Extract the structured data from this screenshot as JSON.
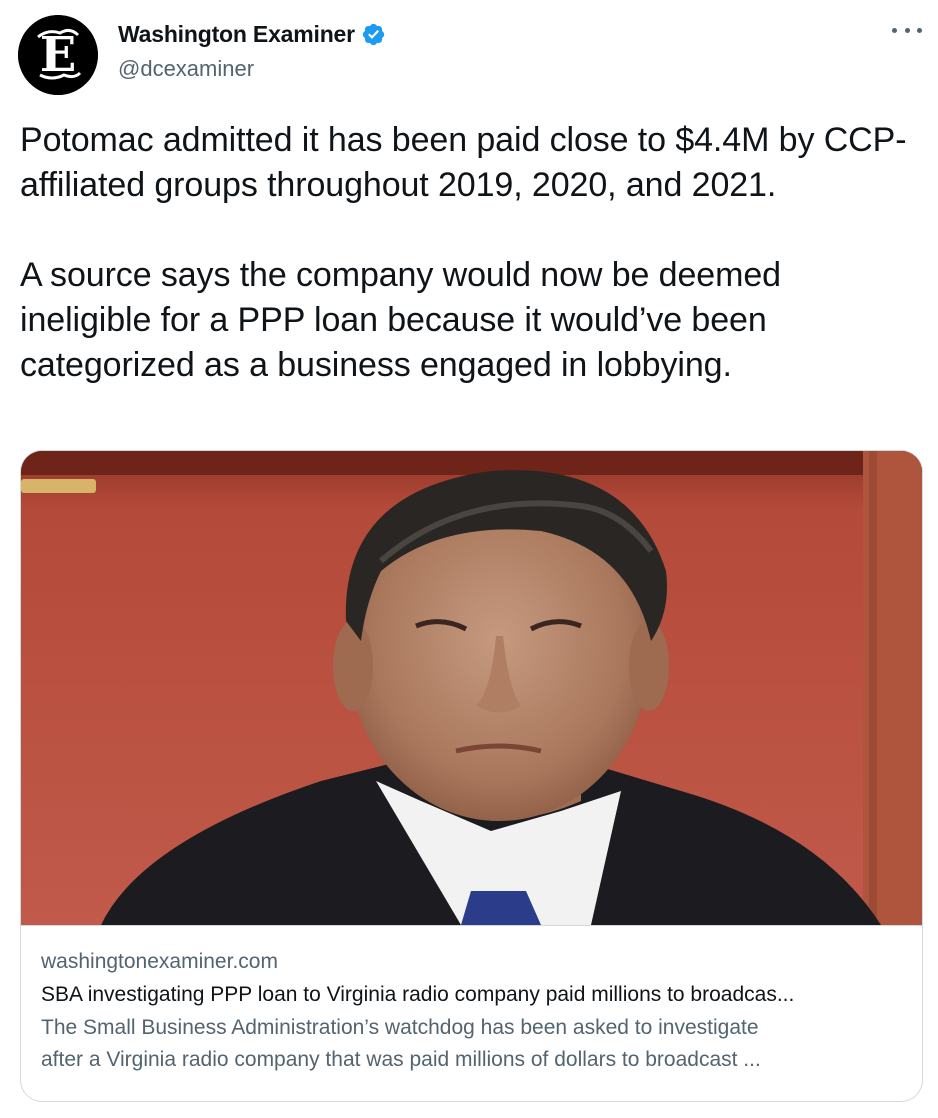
{
  "author": {
    "display_name": "Washington Examiner",
    "handle": "@dcexaminer",
    "verified": true,
    "avatar_glyph": "E"
  },
  "more_menu_icon": "more-horizontal-icon",
  "tweet": {
    "paragraphs": [
      "Potomac admitted it has been paid close to $4.4M by CCP-affiliated groups throughout 2019, 2020, and 2021.",
      "A source says the company would now be deemed ineligible for a PPP loan because it would’ve been categorized as a business engaged in lobbying."
    ]
  },
  "card": {
    "domain": "washingtonexaminer.com",
    "title": "SBA investigating PPP loan to Virginia radio company paid millions to broadcas...",
    "description_lines": [
      "The Small Business Administration’s watchdog has been asked to investigate",
      "after a Virginia radio company that was paid millions of dollars to broadcast ..."
    ]
  },
  "colors": {
    "text_primary": "#0f1419",
    "text_secondary": "#536471",
    "verified_blue": "#1d9bf0",
    "border": "#cfd9de"
  }
}
